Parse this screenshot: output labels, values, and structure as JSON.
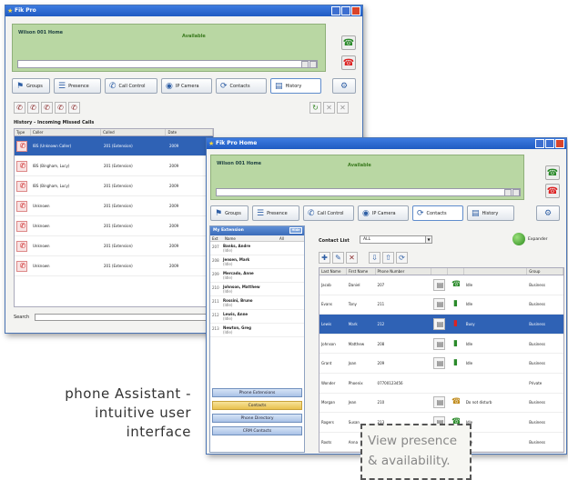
{
  "back_window": {
    "title": "Fik Pro",
    "owner_label": "Wilson  001  Home",
    "status": "Available",
    "tabs": [
      "Groups",
      "Presence",
      "Call Control",
      "IP Camera",
      "Contacts",
      "History"
    ],
    "section_title": "History - Incoming Missed Calls",
    "columns": [
      "Type",
      "Caller",
      "Called",
      "Date"
    ],
    "rows": [
      {
        "caller": "IBS (Unknown Caller)",
        "called": "201 (Extension)",
        "date": "2009"
      },
      {
        "caller": "IBS (Bingham, Lucy)",
        "called": "201 (Extension)",
        "date": "2009"
      },
      {
        "caller": "IBS (Bingham, Lucy)",
        "called": "201 (Extension)",
        "date": "2009"
      },
      {
        "caller": "Unknown",
        "called": "201 (Extension)",
        "date": "2009"
      },
      {
        "caller": "Unknown",
        "called": "201 (Extension)",
        "date": "2009"
      },
      {
        "caller": "Unknown",
        "called": "201 (Extension)",
        "date": "2009"
      },
      {
        "caller": "Unknown",
        "called": "201 (Extension)",
        "date": "2009"
      }
    ],
    "search_label": "Search"
  },
  "front_window": {
    "title": "Fik Pro Home",
    "owner_label": "Wilson  001  Home",
    "status": "Available",
    "tabs": [
      "Groups",
      "Presence",
      "Call Control",
      "IP Camera",
      "Contacts",
      "History"
    ],
    "left_panel": {
      "title": "My Extension",
      "toggle": "Hide",
      "head_ext": "Ext",
      "head_name": "Name",
      "head_all": "All",
      "items": [
        {
          "ext": "207",
          "name": "Banks, Andre",
          "state": "(Idle)"
        },
        {
          "ext": "208",
          "name": "Jensen, Mark",
          "state": "(Idle)"
        },
        {
          "ext": "209",
          "name": "Mercado, Anne",
          "state": "(Idle)"
        },
        {
          "ext": "210",
          "name": "Johnson, Matthew",
          "state": "(Idle)"
        },
        {
          "ext": "211",
          "name": "Rossini, Bruno",
          "state": "(Idle)"
        },
        {
          "ext": "212",
          "name": "Lewis, Anne",
          "state": "(Idle)"
        },
        {
          "ext": "213",
          "name": "Newton, Greg",
          "state": "(Idle)"
        }
      ],
      "buttons": [
        "Phone Extensions",
        "Contacts",
        "Phone Directory",
        "CRM Contacts"
      ]
    },
    "contact_list_label": "Contact List",
    "filter_value": "ALL",
    "expander_label": "Expander",
    "columns": [
      "Last Name",
      "First Name",
      "Phone Number",
      "",
      "",
      "",
      "Group"
    ],
    "rows": [
      {
        "last": "Jacob",
        "first": "Daniel",
        "number": "207",
        "presence": "idle",
        "state": "Idle",
        "group": "Business"
      },
      {
        "last": "Evans",
        "first": "Tony",
        "number": "211",
        "presence": "idle",
        "state": "Idle",
        "group": "Business"
      },
      {
        "last": "Lewis",
        "first": "Mark",
        "number": "212",
        "presence": "busy",
        "state": "Busy",
        "group": "Business"
      },
      {
        "last": "Johnson",
        "first": "Matthew",
        "number": "208",
        "presence": "idle",
        "state": "Idle",
        "group": "Business"
      },
      {
        "last": "Grant",
        "first": "Joan",
        "number": "209",
        "presence": "idle",
        "state": "Idle",
        "group": "Business"
      },
      {
        "last": "Wonder",
        "first": "Phoenix",
        "number": "07700123456",
        "presence": "",
        "state": "",
        "group": "Private"
      },
      {
        "last": "Morgan",
        "first": "Jean",
        "number": "210",
        "presence": "idle",
        "state": "Do not disturb",
        "group": "Business"
      },
      {
        "last": "Rogers",
        "first": "Susan",
        "number": "213",
        "presence": "idle",
        "state": "Idle",
        "group": "Business"
      },
      {
        "last": "Roots",
        "first": "Anna",
        "number": "214",
        "presence": "idle",
        "state": "Idle",
        "group": "Business"
      }
    ]
  },
  "caption": {
    "line1": "phone Assistant -",
    "line2": "intuitive user",
    "line3": "interface"
  },
  "tooltip": {
    "line1": "View presence",
    "line2": "& availability."
  }
}
